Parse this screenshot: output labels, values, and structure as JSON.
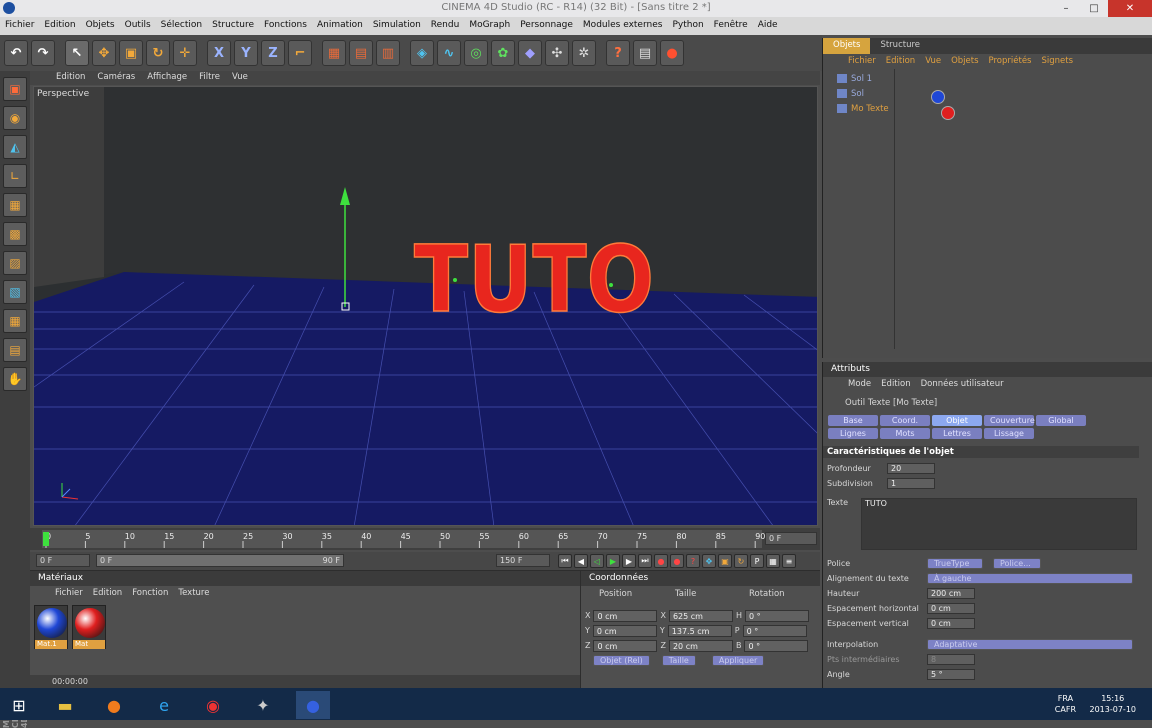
{
  "window": {
    "title": "CINEMA 4D Studio (RC - R14) (32 Bit) - [Sans titre 2 *]"
  },
  "menu": [
    "Fichier",
    "Edition",
    "Objets",
    "Outils",
    "Sélection",
    "Structure",
    "Fonctions",
    "Animation",
    "Simulation",
    "Rendu",
    "MoGraph",
    "Personnage",
    "Modules externes",
    "Python",
    "Fenêtre",
    "Aide"
  ],
  "viewport": {
    "menu": [
      "Edition",
      "Caméras",
      "Affichage",
      "Filtre",
      "Vue"
    ],
    "label": "Perspective",
    "text3d": "TUTO"
  },
  "timeline": {
    "ticks": [
      "0",
      "5",
      "10",
      "15",
      "20",
      "25",
      "30",
      "35",
      "40",
      "45",
      "50",
      "55",
      "60",
      "65",
      "70",
      "75",
      "80",
      "85",
      "90"
    ],
    "end_field": "0 F",
    "start": "0 F",
    "range_start": "0 F",
    "range_end": "90 F",
    "max": "150 F"
  },
  "materials": {
    "title": "Matériaux",
    "menu": [
      "Fichier",
      "Edition",
      "Fonction",
      "Texture"
    ],
    "items": [
      {
        "name": "Mat.1",
        "color": "#1f47d6"
      },
      {
        "name": "Mat",
        "color": "#e01f1f"
      }
    ],
    "time": "00:00:00"
  },
  "coords": {
    "title": "Coordonnées",
    "headers": [
      "Position",
      "Taille",
      "Rotation"
    ],
    "rows": [
      {
        "a": "X",
        "p": "0 cm",
        "b": "X",
        "s": "625 cm",
        "c": "H",
        "r": "0 °"
      },
      {
        "a": "Y",
        "p": "0 cm",
        "b": "Y",
        "s": "137.5 cm",
        "c": "P",
        "r": "0 °"
      },
      {
        "a": "Z",
        "p": "0 cm",
        "b": "Z",
        "s": "20 cm",
        "c": "B",
        "r": "0 °"
      }
    ],
    "mode": "Objet (Rel)",
    "size_mode": "Taille",
    "apply": "Appliquer"
  },
  "objects": {
    "tabs": [
      "Objets",
      "Structure"
    ],
    "menu": [
      "Fichier",
      "Edition",
      "Vue",
      "Objets",
      "Propriétés",
      "Signets"
    ],
    "items": [
      "Sol 1",
      "Sol",
      "Mo Texte"
    ]
  },
  "attributes": {
    "title": "Attributs",
    "menu": [
      "Mode",
      "Edition",
      "Données utilisateur"
    ],
    "object": "Outil Texte [Mo Texte]",
    "tabs": [
      "Base",
      "Coord.",
      "Objet",
      "Couverture",
      "Global",
      "Lignes",
      "Mots",
      "Lettres",
      "Lissage"
    ],
    "section": "Caractéristiques de l'objet",
    "depth_label": "Profondeur",
    "depth": "20",
    "subdiv_label": "Subdivision",
    "subdiv": "1",
    "text_label": "Texte",
    "text": "TUTO",
    "font_label": "Police",
    "font_type": "TrueType",
    "font_btn": "Police...",
    "align_label": "Alignement du texte",
    "align": "À gauche",
    "height_label": "Hauteur",
    "height": "200 cm",
    "hspace_label": "Espacement horizontal",
    "hspace": "0 cm",
    "vspace_label": "Espacement vertical",
    "vspace": "0 cm",
    "interp_label": "Interpolation",
    "interp": "Adaptative",
    "steps_label": "Pts intermédiaires",
    "steps": "8",
    "angle_label": "Angle",
    "angle": "5 °"
  },
  "taskbar": {
    "lang1": "FRA",
    "lang2": "CAFR",
    "time": "15:16",
    "date": "2013-07-10"
  },
  "colors": {
    "text3d": "#e8261e",
    "floor": "#151a63",
    "accent": "#d6a43e"
  }
}
